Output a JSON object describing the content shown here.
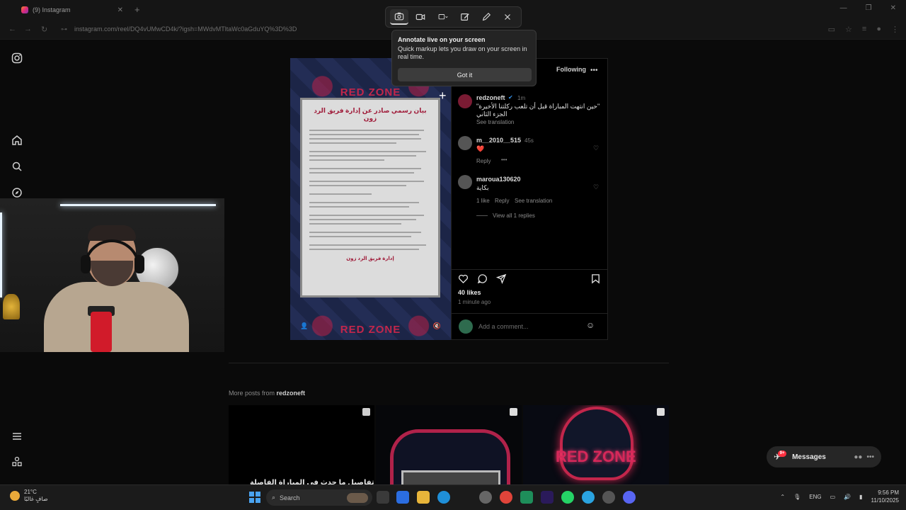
{
  "browser": {
    "tab_title": "(9) Instagram",
    "url": "instagram.com/reel/DQ4vUMwCD4k/?igsh=MWdvMTltaWc0aGduYQ%3D%3D"
  },
  "snip_tool": {
    "tooltip_title": "Annotate live on your screen",
    "tooltip_body": "Quick markup lets you draw on your screen in real time.",
    "got_it": "Got it"
  },
  "reel": {
    "brand": "RED ZONE",
    "doc_title": "بيان رسمي صادر عن إدارة فريق الرد زون",
    "doc_signature": "إدارة فريق الرد زون"
  },
  "post": {
    "following": "Following",
    "author": "redzoneft",
    "author_time": "1m",
    "caption": "\"حين انتهت المباراة قبل أن تلعب ركلتنا الأخيرة\" الجزء الثاني",
    "see_translation": "See translation",
    "comments": [
      {
        "user": "m__2010__515",
        "time": "45s",
        "text": "❤️",
        "reply": "Reply",
        "likes": ""
      },
      {
        "user": "maroua130620",
        "time": "",
        "text": "بكاية",
        "reply": "Reply",
        "likes": "1 like",
        "see_translation": "See translation",
        "view_replies": "View all 1 replies"
      }
    ],
    "likes": "40 likes",
    "time_ago": "1 minute ago",
    "add_comment_placeholder": "Add a comment..."
  },
  "more_posts": {
    "label": "More posts from",
    "user": "redzoneft",
    "thumb_caption": "تفاصيل ما حدث في المباراة الفاصلة"
  },
  "messages": {
    "label": "Messages",
    "badge": "9+"
  },
  "taskbar": {
    "temp": "21°C",
    "weather": "صافٍ غالبًا",
    "search": "Search",
    "lang": "ENG",
    "time": "9:56 PM",
    "date": "11/10/2025"
  },
  "colors": {
    "accent_red": "#c2264b",
    "ig_bg": "#000000"
  }
}
